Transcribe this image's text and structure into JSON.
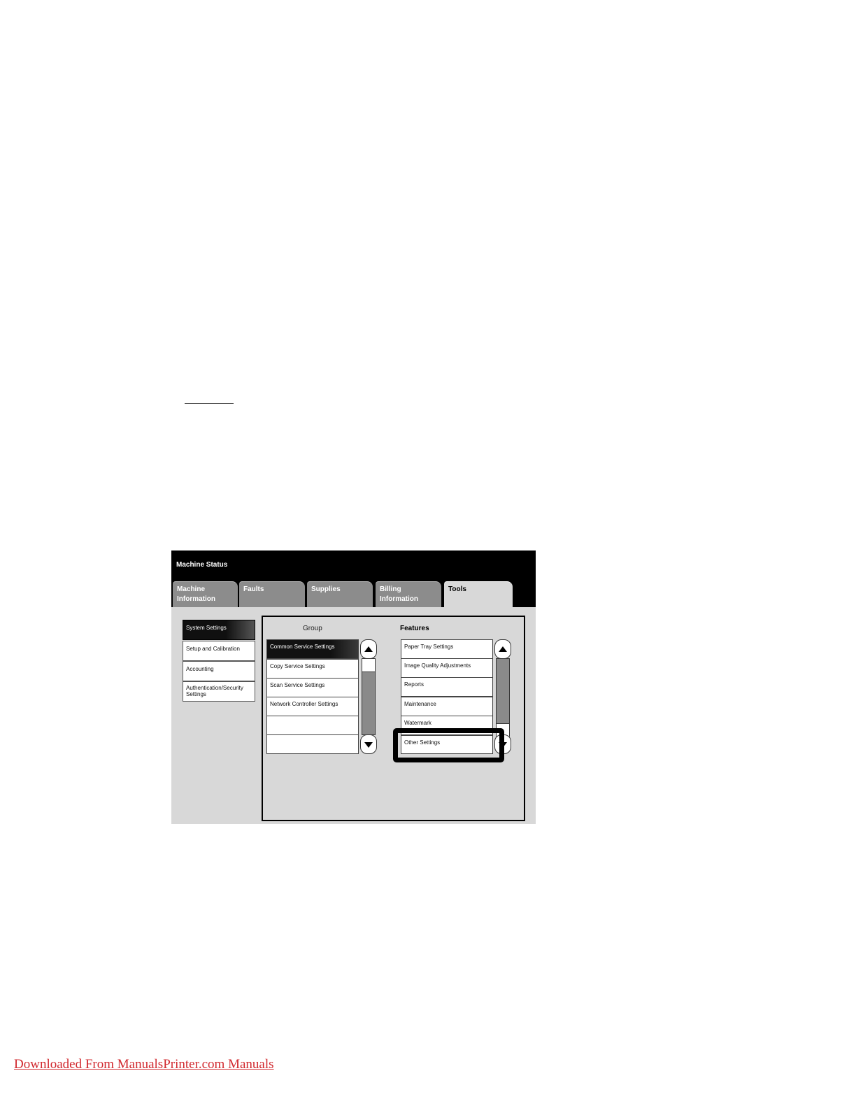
{
  "header": {
    "title": "Machine Status"
  },
  "tabs": [
    {
      "line1": "Machine",
      "line2": "Information",
      "active": false
    },
    {
      "line1": "Faults",
      "line2": "",
      "active": false
    },
    {
      "line1": "Supplies",
      "line2": "",
      "active": false
    },
    {
      "line1": "Billing",
      "line2": "Information",
      "active": false
    },
    {
      "line1": "Tools",
      "line2": "",
      "active": true
    }
  ],
  "left_menu": [
    {
      "label": "System Settings",
      "selected": true
    },
    {
      "label": "Setup and Calibration",
      "selected": false
    },
    {
      "label": "Accounting",
      "selected": false
    },
    {
      "label": "Authentication/Security",
      "label2": "Settings",
      "selected": false
    }
  ],
  "group": {
    "heading": "Group",
    "items": [
      {
        "label": "Common Service Settings",
        "selected": true
      },
      {
        "label": "Copy Service Settings"
      },
      {
        "label": "Scan Service Settings"
      },
      {
        "label": "Network Controller Settings"
      },
      {
        "label": ""
      },
      {
        "label": ""
      }
    ]
  },
  "features": {
    "heading": "Features",
    "items": [
      {
        "label": "Paper Tray Settings"
      },
      {
        "label": "Image Quality Adjustments"
      },
      {
        "label": "Reports"
      },
      {
        "label": "Maintenance"
      },
      {
        "label": "Watermark"
      },
      {
        "label": "Other Settings",
        "highlighted": true
      }
    ]
  },
  "footer": {
    "link_text": "Downloaded From ManualsPrinter.com Manuals"
  }
}
